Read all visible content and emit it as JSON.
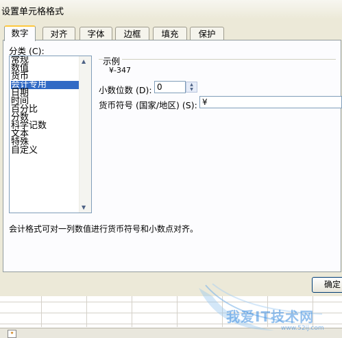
{
  "dialog": {
    "title": "设置单元格格式",
    "tabs": [
      {
        "label": "数字",
        "active": true
      },
      {
        "label": "对齐"
      },
      {
        "label": "字体"
      },
      {
        "label": "边框"
      },
      {
        "label": "填充"
      },
      {
        "label": "保护"
      }
    ],
    "category_label": "分类 (C):",
    "categories": [
      "常规",
      "数值",
      "货币",
      "会计专用",
      "日期",
      "时间",
      "百分比",
      "分数",
      "科学记数",
      "文本",
      "特殊",
      "自定义"
    ],
    "selected_category": "会计专用",
    "sample": {
      "legend": "示例",
      "value": "¥-347"
    },
    "decimal_places": {
      "label": "小数位数 (D):",
      "value": "0"
    },
    "currency_symbol": {
      "label": "货币符号 (国家/地区) (S):",
      "value": "¥"
    },
    "description": "会计格式可对一列数值进行货币符号和小数点对齐。",
    "ok_button": "确定"
  },
  "watermark": {
    "text": "我爱IT技术网",
    "url": "www.52ij.com"
  },
  "colors": {
    "selection": "#316ac5",
    "dialog_bg": "#ece9d8",
    "active_tab_accent": "#ffc83c"
  }
}
